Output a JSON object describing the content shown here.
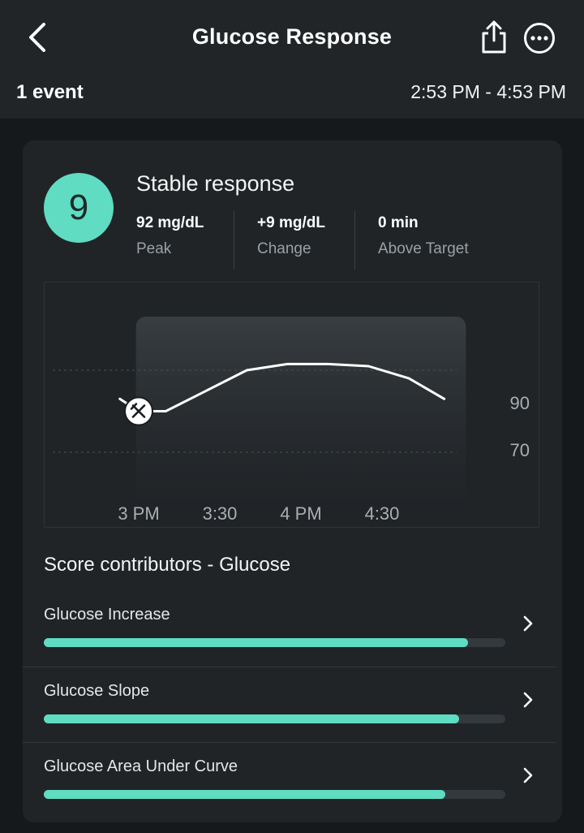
{
  "header": {
    "title": "Glucose Response",
    "event_count": "1 event",
    "time_range": "2:53 PM - 4:53 PM"
  },
  "icons": {
    "back": "chevron-left-icon",
    "share": "share-icon",
    "more": "more-horizontal-icon",
    "meal": "fork-knife-icon",
    "row_chevron": "chevron-right-icon"
  },
  "summary": {
    "score": "9",
    "response_label": "Stable response",
    "metrics": [
      {
        "value": "92  mg/dL",
        "label": "Peak"
      },
      {
        "value": "+9  mg/dL",
        "label": "Change"
      },
      {
        "value": "0  min",
        "label": "Above Target"
      }
    ]
  },
  "colors": {
    "accent": "#5fdcc2",
    "background": "#16191c",
    "header": "#212528",
    "card": "#202427"
  },
  "chart_data": {
    "type": "line",
    "x_ticks": [
      "3 PM",
      "3:30",
      "4 PM",
      "4:30"
    ],
    "y_ticks": [
      "90",
      "70"
    ],
    "x": [
      "2:53 PM",
      "3:00 PM",
      "3:05 PM",
      "3:10 PM",
      "3:25 PM",
      "3:40 PM",
      "3:55 PM",
      "4:10 PM",
      "4:25 PM",
      "4:40 PM",
      "4:53 PM"
    ],
    "values": [
      83,
      80,
      80,
      80,
      85,
      90,
      91.5,
      91.5,
      91,
      88,
      83
    ],
    "meal_marker_time": "3:00 PM",
    "highlight_window": [
      "2:59 PM",
      "5:01 PM"
    ],
    "ylim": [
      60,
      110
    ],
    "grid": "dashed at 70 and 90"
  },
  "contributors": {
    "title": "Score contributors - Glucose",
    "items": [
      {
        "label": "Glucose Increase",
        "score": 0.92
      },
      {
        "label": "Glucose Slope",
        "score": 0.9
      },
      {
        "label": "Glucose Area Under Curve",
        "score": 0.87
      }
    ]
  }
}
